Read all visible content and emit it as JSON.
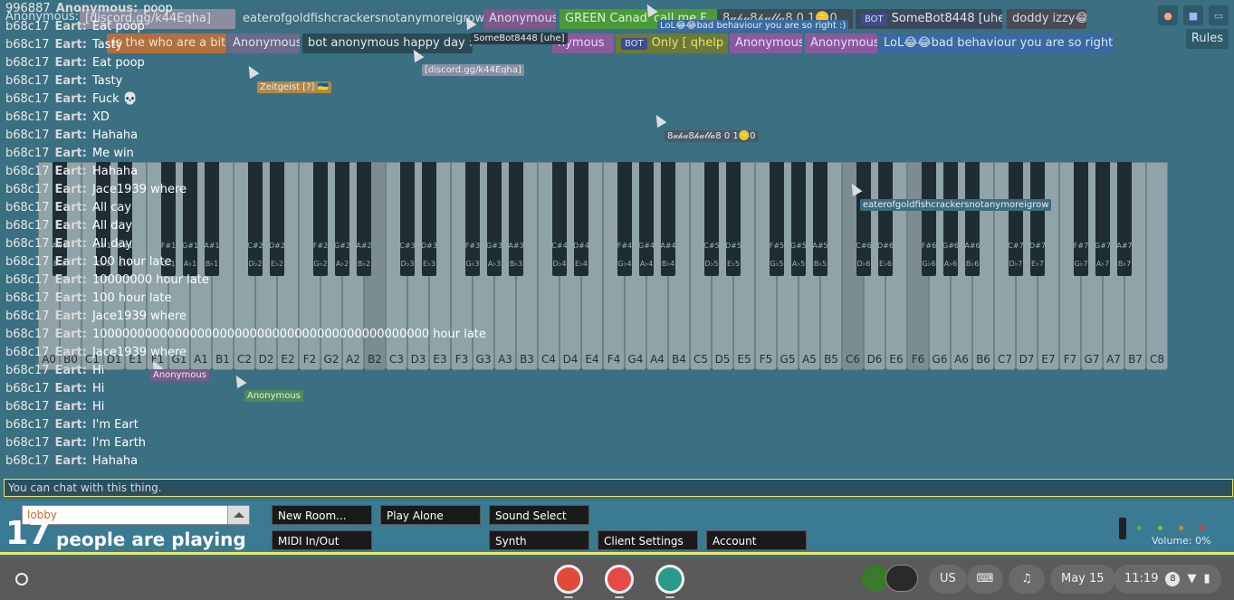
{
  "top_users": [
    {
      "label": "Anonymous: poop",
      "bot": false,
      "bg": "#3d6f82",
      "fg": "#cfe1e8"
    },
    {
      "label": "[discord.gg/k44Eqha]",
      "bot": false,
      "bg": "#8a8ea0",
      "fg": "#e0e0e8"
    },
    {
      "label": "eaterofgoldfishcrackersnotanymoreigrow",
      "bot": false,
      "bg": "#3c6c7e",
      "fg": "#d7e2e6"
    },
    {
      "label": "Anonymous",
      "bot": false,
      "bg": "#7a5a8c",
      "fg": "#e6d6ee"
    },
    {
      "label": "GREEN Canada",
      "bot": false,
      "bg": "#4a9a3a",
      "fg": "#dff0d8"
    },
    {
      "label": "call me F",
      "bot": false,
      "bg": "#4a9a3a",
      "fg": "#dff0d8"
    },
    {
      "label": "8𝓊𝒽𝓊8𝒽𝓊𝓁𝓁𝒶8 0    1🪙0",
      "bot": false,
      "bg": "#3c4c55",
      "fg": "#d0d0d0"
    },
    {
      "label": "SomeBot8448 [uhe]",
      "bot": true,
      "bg": "#3a4a5a",
      "fg": "#e0e6f0"
    },
    {
      "label": "doddy izzy😂",
      "bot": false,
      "bg": "#4a4a55",
      "fg": "#dddddd"
    },
    {
      "label": "is the who are a bitch",
      "bot": false,
      "bg": "#b07040",
      "fg": "#f3e1d1"
    },
    {
      "label": "Anonymous",
      "bot": false,
      "bg": "#6a6a8a",
      "fg": "#e0e0ee"
    },
    {
      "label": "bot anonymous happy day :D",
      "bot": false,
      "bg": "#2a4a56",
      "fg": "#e8e8e8"
    },
    {
      "label": "nymous",
      "bot": false,
      "bg": "#8a5a9a",
      "fg": "#ead8f2"
    },
    {
      "label": "Only [ qhelp ]",
      "bot": true,
      "bg": "#6a7a3a",
      "fg": "#f0e060"
    },
    {
      "label": "Anonymous",
      "bot": false,
      "bg": "#8a5aa0",
      "fg": "#ead8f2"
    },
    {
      "label": "Anonymous",
      "bot": false,
      "bg": "#8a5aa0",
      "fg": "#ead8f2"
    },
    {
      "label": "LoL😂😂bad behaviour you are so right :)",
      "bot": false,
      "bg": "#3a6aa0",
      "fg": "#d8e6f4"
    }
  ],
  "top_right": {
    "reddit_icon": "reddit-icon",
    "discord_icon": "discord-icon",
    "room_icon": "window-icon",
    "rules_label": "Rules"
  },
  "cursors": [
    {
      "name": "",
      "color": "transparent"
    },
    {
      "name": "SomeBot8448 [uhe]",
      "color": "#2a3a44"
    },
    {
      "name": "[discord.gg/k44Eqha]",
      "color": "#8a8ea0"
    },
    {
      "name": "Zeitgeist [?] 🇺🇦",
      "color": "#b0884a"
    },
    {
      "name": "LoL😂😂bad behaviour you are so right :)",
      "color": "#3a6aa0"
    },
    {
      "name": "8𝓊𝒽𝓊8𝒽𝓊𝓁𝓁𝒶8 0    1🪙0",
      "color": "#4a5a66"
    },
    {
      "name": "eaterofgoldfishcrackersnotanymoreigrow",
      "color": "#3c6c7e"
    },
    {
      "name": "Anonymous",
      "color": "#7a5a8c"
    },
    {
      "name": "Anonymous",
      "color": "#4a8a5a"
    }
  ],
  "piano": {
    "white_keys": [
      "A0",
      "B0",
      "C1",
      "D1",
      "E1",
      "F1",
      "G1",
      "A1",
      "B1",
      "C2",
      "D2",
      "E2",
      "F2",
      "G2",
      "A2",
      "B2",
      "C3",
      "D3",
      "E3",
      "F3",
      "G3",
      "A3",
      "B3",
      "C4",
      "D4",
      "E4",
      "F4",
      "G4",
      "A4",
      "B4",
      "C5",
      "D5",
      "E5",
      "F5",
      "G5",
      "A5",
      "B5",
      "C6",
      "D6",
      "E6",
      "F6",
      "G6",
      "A6",
      "B6",
      "C7",
      "D7",
      "E7",
      "F7",
      "G7",
      "A7",
      "B7",
      "C8"
    ],
    "black_keys": [
      {
        "sharp": "A#0",
        "flat": "B♭0"
      },
      {
        "sharp": "C#1",
        "flat": "D♭1"
      },
      {
        "sharp": "D#1",
        "flat": "E♭1"
      },
      {
        "sharp": "F#1",
        "flat": "G♭1"
      },
      {
        "sharp": "G#1",
        "flat": "A♭1"
      },
      {
        "sharp": "A#1",
        "flat": "B♭1"
      },
      {
        "sharp": "C#2",
        "flat": "D♭2"
      },
      {
        "sharp": "D#2",
        "flat": "E♭2"
      },
      {
        "sharp": "F#2",
        "flat": "G♭2"
      },
      {
        "sharp": "G#2",
        "flat": "A♭2"
      },
      {
        "sharp": "A#2",
        "flat": "B♭2"
      },
      {
        "sharp": "C#3",
        "flat": "D♭3"
      },
      {
        "sharp": "D#3",
        "flat": "E♭3"
      },
      {
        "sharp": "F#3",
        "flat": "G♭3"
      },
      {
        "sharp": "G#3",
        "flat": "A♭3"
      },
      {
        "sharp": "A#3",
        "flat": "B♭3"
      },
      {
        "sharp": "C#4",
        "flat": "D♭4"
      },
      {
        "sharp": "D#4",
        "flat": "E♭4"
      },
      {
        "sharp": "F#4",
        "flat": "G♭4"
      },
      {
        "sharp": "G#4",
        "flat": "A♭4"
      },
      {
        "sharp": "A#4",
        "flat": "B♭4"
      },
      {
        "sharp": "C#5",
        "flat": "D♭5"
      },
      {
        "sharp": "D#5",
        "flat": "E♭5"
      },
      {
        "sharp": "F#5",
        "flat": "G♭5"
      },
      {
        "sharp": "G#5",
        "flat": "A♭5"
      },
      {
        "sharp": "A#5",
        "flat": "B♭5"
      },
      {
        "sharp": "C#6",
        "flat": "D♭6"
      },
      {
        "sharp": "D#6",
        "flat": "E♭6"
      },
      {
        "sharp": "F#6",
        "flat": "G♭6"
      },
      {
        "sharp": "G#6",
        "flat": "A♭6"
      },
      {
        "sharp": "A#6",
        "flat": "B♭6"
      },
      {
        "sharp": "C#7",
        "flat": "D♭7"
      },
      {
        "sharp": "D#7",
        "flat": "E♭7"
      },
      {
        "sharp": "F#7",
        "flat": "G♭7"
      },
      {
        "sharp": "G#7",
        "flat": "A♭7"
      },
      {
        "sharp": "A#7",
        "flat": "B♭7"
      }
    ],
    "pressed_keys": [
      "B2",
      "C6",
      "F6"
    ]
  },
  "chat": {
    "messages": [
      {
        "id": "996887",
        "user": "Anonymous:",
        "text": "poop"
      },
      {
        "id": "b68c17",
        "user": "Eart:",
        "text": "Eat poop"
      },
      {
        "id": "b68c17",
        "user": "Eart:",
        "text": "Tasty"
      },
      {
        "id": "b68c17",
        "user": "Eart:",
        "text": "Eat poop"
      },
      {
        "id": "b68c17",
        "user": "Eart:",
        "text": "Tasty"
      },
      {
        "id": "b68c17",
        "user": "Eart:",
        "text": "Fuck 💀"
      },
      {
        "id": "b68c17",
        "user": "Eart:",
        "text": "XD"
      },
      {
        "id": "b68c17",
        "user": "Eart:",
        "text": "Hahaha"
      },
      {
        "id": "b68c17",
        "user": "Eart:",
        "text": "Me win"
      },
      {
        "id": "b68c17",
        "user": "Eart:",
        "text": "Hahaha"
      },
      {
        "id": "b68c17",
        "user": "Eart:",
        "text": "Jace1939 where"
      },
      {
        "id": "b68c17",
        "user": "Eart:",
        "text": "All cay"
      },
      {
        "id": "b68c17",
        "user": "Eart:",
        "text": "All day"
      },
      {
        "id": "b68c17",
        "user": "Eart:",
        "text": "All day"
      },
      {
        "id": "b68c17",
        "user": "Eart:",
        "text": "100 hour late"
      },
      {
        "id": "b68c17",
        "user": "Eart:",
        "text": "10000000 hour late"
      },
      {
        "id": "b68c17",
        "user": "Eart:",
        "text": "100 hour late"
      },
      {
        "id": "b68c17",
        "user": "Eart:",
        "text": "Jace1939 where"
      },
      {
        "id": "b68c17",
        "user": "Eart:",
        "text": "100000000000000000000000000000000000000000000 hour late"
      },
      {
        "id": "b68c17",
        "user": "Eart:",
        "text": "Jace1939 where"
      },
      {
        "id": "b68c17",
        "user": "Eart:",
        "text": "Hi"
      },
      {
        "id": "b68c17",
        "user": "Eart:",
        "text": "Hi"
      },
      {
        "id": "b68c17",
        "user": "Eart:",
        "text": "Hi"
      },
      {
        "id": "b68c17",
        "user": "Eart:",
        "text": "I'm Eart"
      },
      {
        "id": "b68c17",
        "user": "Eart:",
        "text": "I'm Earth"
      },
      {
        "id": "b68c17",
        "user": "Eart:",
        "text": "Hahaha"
      }
    ],
    "input_placeholder": "You can chat with this thing."
  },
  "bottom": {
    "room_name": "lobby",
    "player_count": "17",
    "player_count_text": "people are playing",
    "buttons": {
      "new_room": "New Room...",
      "play_alone": "Play Alone",
      "sound_select": "Sound Select",
      "midi": "MIDI In/Out",
      "synth": "Synth",
      "client_settings": "Client Settings",
      "account": "Account"
    },
    "volume_label": "Volume: 0%",
    "volume_level": 0,
    "volume_dots": [
      "#3fbf4a",
      "#7fbf3a",
      "#d08a2a",
      "#e03030"
    ]
  },
  "taskbar": {
    "launcher_icon": "launcher-icon",
    "apps": [
      {
        "name": "chrome-icon",
        "color": "#e04a3a"
      },
      {
        "name": "paint-app-icon",
        "color": "#e84848"
      },
      {
        "name": "classroom-app-icon",
        "color": "#2a9a8a"
      }
    ],
    "ime": "US",
    "keyboard_icon": "keyboard-icon",
    "media_icon": "media-queue-icon",
    "date": "May 15",
    "time": "11:19",
    "notification_count": "8",
    "wifi_icon": "wifi-icon",
    "battery_icon": "battery-icon"
  }
}
